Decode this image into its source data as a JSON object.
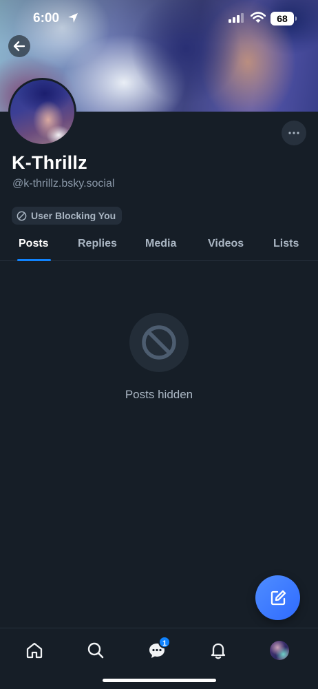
{
  "status_bar": {
    "time": "6:00",
    "battery": "68"
  },
  "profile": {
    "display_name": "K-Thrillz",
    "handle": "@k-thrillz.bsky.social",
    "block_badge": "User Blocking You"
  },
  "tabs": [
    {
      "label": "Posts",
      "active": true
    },
    {
      "label": "Replies",
      "active": false
    },
    {
      "label": "Media",
      "active": false
    },
    {
      "label": "Videos",
      "active": false
    },
    {
      "label": "Lists",
      "active": false
    }
  ],
  "empty_state": {
    "icon": "block-icon",
    "text": "Posts hidden"
  },
  "bottom_nav": {
    "items": [
      {
        "icon": "home-icon"
      },
      {
        "icon": "search-icon"
      },
      {
        "icon": "chat-icon",
        "badge": "1"
      },
      {
        "icon": "bell-icon"
      },
      {
        "icon": "profile-avatar"
      }
    ]
  },
  "colors": {
    "background": "#161e27",
    "accent": "#1083fe",
    "muted_text": "#aab6c3",
    "fab": "#3a79ff"
  }
}
